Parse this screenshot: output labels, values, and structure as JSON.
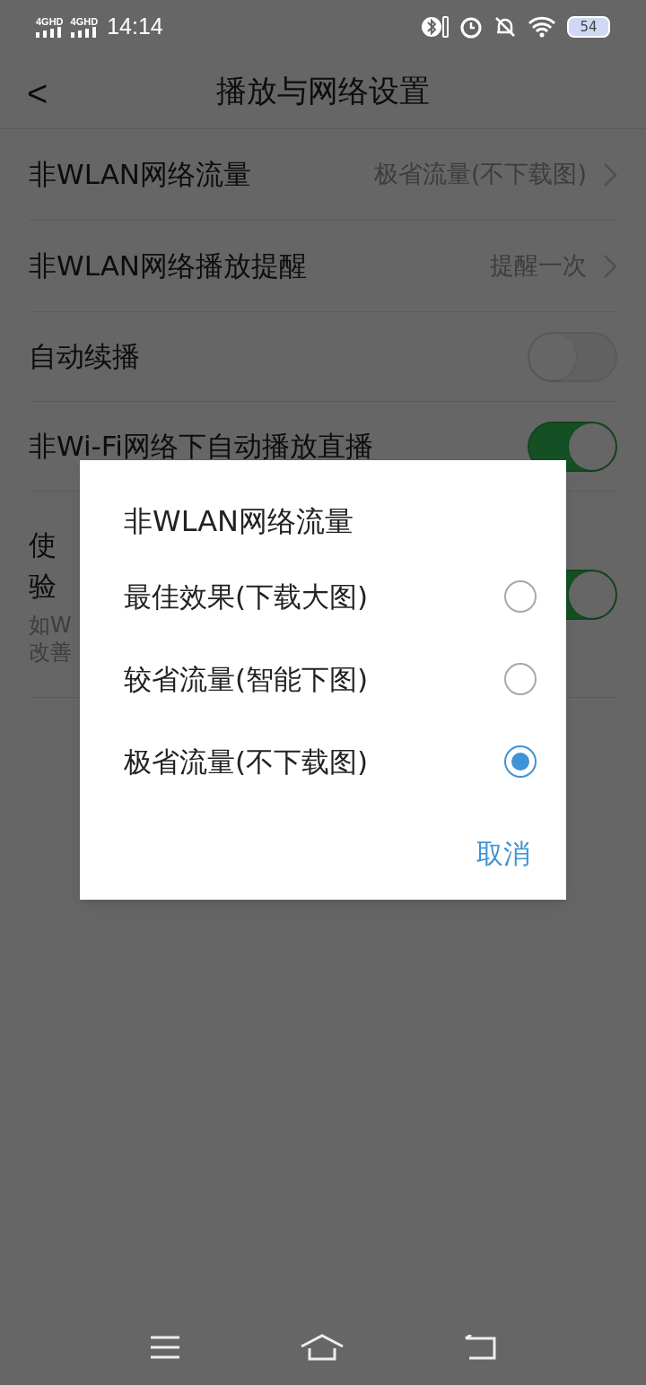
{
  "status_bar": {
    "signals": [
      "4GHD",
      "4GHD"
    ],
    "time": "14:14",
    "battery": "54"
  },
  "header": {
    "back": "<",
    "title": "播放与网络设置"
  },
  "settings": [
    {
      "kind": "value",
      "label": "非WLAN网络流量",
      "value": "极省流量(不下载图)"
    },
    {
      "kind": "value",
      "label": "非WLAN网络播放提醒",
      "value": "提醒一次"
    },
    {
      "kind": "toggle",
      "label": "自动续播",
      "on": false
    },
    {
      "kind": "toggle",
      "label": "非Wi-Fi网络下自动播放直播",
      "on": true
    },
    {
      "kind": "toggle",
      "label_lines": [
        "使",
        "验"
      ],
      "description_lines": [
        "如W",
        "改善"
      ],
      "on": true
    }
  ],
  "dialog": {
    "title": "非WLAN网络流量",
    "options": [
      {
        "label": "最佳效果(下载大图)",
        "selected": false
      },
      {
        "label": "较省流量(智能下图)",
        "selected": false
      },
      {
        "label": "极省流量(不下载图)",
        "selected": true
      }
    ],
    "cancel": "取消"
  }
}
